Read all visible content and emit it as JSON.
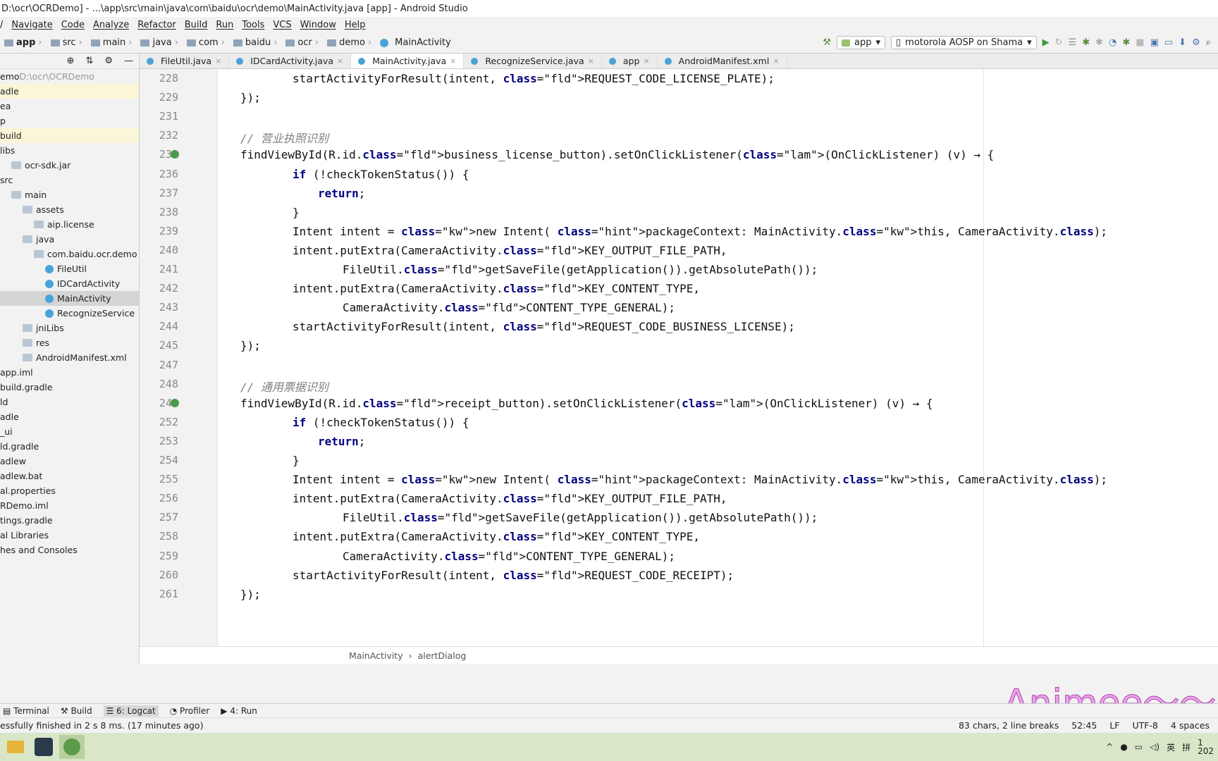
{
  "window": {
    "title": "D:\\ocr\\OCRDemo] - ...\\app\\src\\main\\java\\com\\baidu\\ocr\\demo\\MainActivity.java [app] - Android Studio"
  },
  "menu": [
    "Navigate",
    "Code",
    "Analyze",
    "Refactor",
    "Build",
    "Run",
    "Tools",
    "VCS",
    "Window",
    "Help"
  ],
  "breadcrumbs": [
    "app",
    "src",
    "main",
    "java",
    "com",
    "baidu",
    "ocr",
    "demo",
    "MainActivity"
  ],
  "toolbar": {
    "config": "app",
    "device": "motorola AOSP on Shama"
  },
  "tabs": [
    {
      "label": "FileUtil.java",
      "active": false
    },
    {
      "label": "IDCardActivity.java",
      "active": false
    },
    {
      "label": "MainActivity.java",
      "active": true
    },
    {
      "label": "RecognizeService.java",
      "active": false
    },
    {
      "label": "app",
      "active": false
    },
    {
      "label": "AndroidManifest.xml",
      "active": false
    }
  ],
  "project_tree": [
    {
      "label": "emo",
      "sub": "D:\\ocr\\OCRDemo",
      "indent": 0,
      "state": ""
    },
    {
      "label": "adle",
      "indent": 0,
      "state": "hl"
    },
    {
      "label": "ea",
      "indent": 0,
      "state": ""
    },
    {
      "label": "p",
      "indent": 0,
      "state": ""
    },
    {
      "label": "build",
      "indent": 0,
      "state": "hl"
    },
    {
      "label": "libs",
      "indent": 0,
      "state": ""
    },
    {
      "label": "ocr-sdk.jar",
      "indent": 1,
      "state": ""
    },
    {
      "label": "src",
      "indent": 0,
      "state": ""
    },
    {
      "label": "main",
      "indent": 1,
      "state": ""
    },
    {
      "label": "assets",
      "indent": 2,
      "state": ""
    },
    {
      "label": "aip.license",
      "indent": 3,
      "state": ""
    },
    {
      "label": "java",
      "indent": 2,
      "state": ""
    },
    {
      "label": "com.baidu.ocr.demo",
      "indent": 3,
      "state": ""
    },
    {
      "label": "FileUtil",
      "indent": 4,
      "state": "",
      "cls": true
    },
    {
      "label": "IDCardActivity",
      "indent": 4,
      "state": "",
      "cls": true
    },
    {
      "label": "MainActivity",
      "indent": 4,
      "state": "sel",
      "cls": true
    },
    {
      "label": "RecognizeService",
      "indent": 4,
      "state": "",
      "cls": true
    },
    {
      "label": "jniLibs",
      "indent": 2,
      "state": ""
    },
    {
      "label": "res",
      "indent": 2,
      "state": ""
    },
    {
      "label": "AndroidManifest.xml",
      "indent": 2,
      "state": ""
    },
    {
      "label": "app.iml",
      "indent": 0,
      "state": ""
    },
    {
      "label": "build.gradle",
      "indent": 0,
      "state": ""
    },
    {
      "label": "ld",
      "indent": 0,
      "state": ""
    },
    {
      "label": "adle",
      "indent": 0,
      "state": ""
    },
    {
      "label": "_ui",
      "indent": 0,
      "state": ""
    },
    {
      "label": "ld.gradle",
      "indent": 0,
      "state": ""
    },
    {
      "label": "adlew",
      "indent": 0,
      "state": ""
    },
    {
      "label": "adlew.bat",
      "indent": 0,
      "state": ""
    },
    {
      "label": "al.properties",
      "indent": 0,
      "state": ""
    },
    {
      "label": "RDemo.iml",
      "indent": 0,
      "state": ""
    },
    {
      "label": "tings.gradle",
      "indent": 0,
      "state": ""
    },
    {
      "label": "al Libraries",
      "indent": 0,
      "state": ""
    },
    {
      "label": "hes and Consoles",
      "indent": 0,
      "state": ""
    }
  ],
  "line_numbers": [
    "228",
    "229",
    "231",
    "232",
    "233",
    "236",
    "237",
    "238",
    "239",
    "240",
    "241",
    "242",
    "243",
    "244",
    "245",
    "247",
    "248",
    "249",
    "252",
    "253",
    "254",
    "255",
    "256",
    "257",
    "258",
    "259",
    "260",
    "261"
  ],
  "code_lines": [
    "startActivityForResult(intent, REQUEST_CODE_LICENSE_PLATE);",
    "});",
    "",
    "// 营业执照识别",
    "findViewById(R.id.business_license_button).setOnClickListener((OnClickListener) (v) → {",
    "if (!checkTokenStatus()) {",
    "return;",
    "}",
    "Intent intent = new Intent( packageContext: MainActivity.this, CameraActivity.class);",
    "intent.putExtra(CameraActivity.KEY_OUTPUT_FILE_PATH,",
    "FileUtil.getSaveFile(getApplication()).getAbsolutePath());",
    "intent.putExtra(CameraActivity.KEY_CONTENT_TYPE,",
    "CameraActivity.CONTENT_TYPE_GENERAL);",
    "startActivityForResult(intent, REQUEST_CODE_BUSINESS_LICENSE);",
    "});",
    "",
    "// 通用票据识别",
    "findViewById(R.id.receipt_button).setOnClickListener((OnClickListener) (v) → {",
    "if (!checkTokenStatus()) {",
    "return;",
    "}",
    "Intent intent = new Intent( packageContext: MainActivity.this, CameraActivity.class);",
    "intent.putExtra(CameraActivity.KEY_OUTPUT_FILE_PATH,",
    "FileUtil.getSaveFile(getApplication()).getAbsolutePath());",
    "intent.putExtra(CameraActivity.KEY_CONTENT_TYPE,",
    "CameraActivity.CONTENT_TYPE_GENERAL);",
    "startActivityForResult(intent, REQUEST_CODE_RECEIPT);",
    "});"
  ],
  "editor_breadcrumb": [
    "MainActivity",
    "alertDialog"
  ],
  "tool_windows": [
    "Terminal",
    "Build",
    "6: Logcat",
    "Profiler",
    "4: Run"
  ],
  "status": {
    "message": "essfully finished in 2 s 8 ms. (17 minutes ago)",
    "selection": "83 chars, 2 line breaks",
    "position": "52:45",
    "line_sep": "LF",
    "encoding": "UTF-8",
    "indent": "4 spaces"
  },
  "tray": {
    "ime": "英",
    "ime2": "拼",
    "clock": "1",
    "date": "202"
  },
  "watermark": "Animee～～鬼"
}
